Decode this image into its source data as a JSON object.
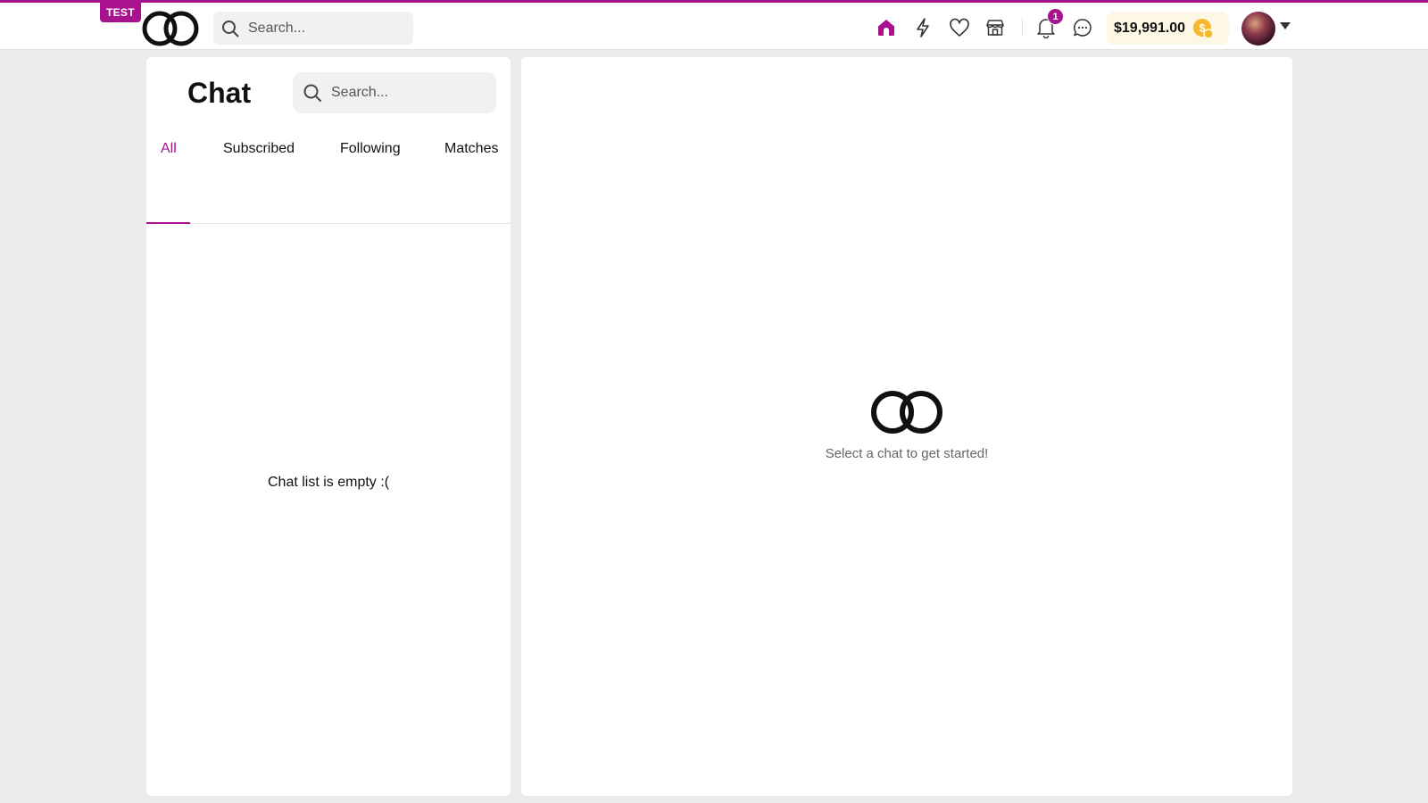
{
  "header": {
    "env_badge": "TEST",
    "search": {
      "placeholder": "Search...",
      "value": ""
    },
    "nav_icons": [
      "home-icon",
      "lightning-icon",
      "heart-icon",
      "store-icon",
      "bell-icon",
      "chat-bubble-icon"
    ],
    "active_nav": "home-icon",
    "notification_count": "1",
    "balance": "$19,991.00",
    "colors": {
      "accent": "#a8128f",
      "coin": "#f5b82e"
    }
  },
  "chat_panel": {
    "title": "Chat",
    "search": {
      "placeholder": "Search...",
      "value": ""
    },
    "tabs": [
      {
        "label": "All",
        "active": true
      },
      {
        "label": "Subscribed",
        "active": false
      },
      {
        "label": "Following",
        "active": false
      },
      {
        "label": "Matches",
        "active": false
      }
    ],
    "empty_message": "Chat list is empty :("
  },
  "conversation_panel": {
    "placeholder_message": "Select a chat to get started!"
  }
}
